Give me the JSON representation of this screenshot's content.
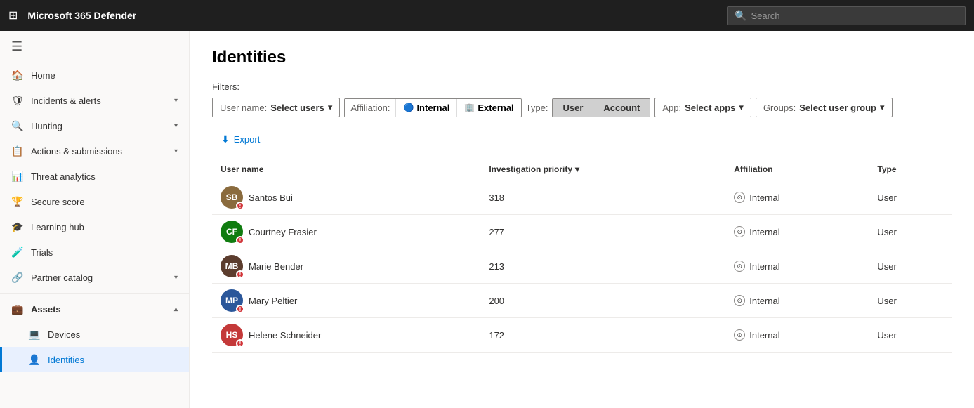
{
  "topbar": {
    "title": "Microsoft 365 Defender",
    "search_placeholder": "Search"
  },
  "sidebar": {
    "toggle_label": "Menu",
    "items": [
      {
        "id": "home",
        "label": "Home",
        "icon": "🏠",
        "expandable": false
      },
      {
        "id": "incidents",
        "label": "Incidents & alerts",
        "icon": "🛡",
        "expandable": true
      },
      {
        "id": "hunting",
        "label": "Hunting",
        "icon": "🔍",
        "expandable": true
      },
      {
        "id": "actions",
        "label": "Actions & submissions",
        "icon": "📋",
        "expandable": true
      },
      {
        "id": "threat",
        "label": "Threat analytics",
        "icon": "📊",
        "expandable": false
      },
      {
        "id": "score",
        "label": "Secure score",
        "icon": "🏆",
        "expandable": false
      },
      {
        "id": "learning",
        "label": "Learning hub",
        "icon": "🎓",
        "expandable": false
      },
      {
        "id": "trials",
        "label": "Trials",
        "icon": "🧪",
        "expandable": false
      },
      {
        "id": "partner",
        "label": "Partner catalog",
        "icon": "🔗",
        "expandable": true
      },
      {
        "id": "assets",
        "label": "Assets",
        "icon": "💼",
        "expandable": true,
        "section": true
      },
      {
        "id": "devices",
        "label": "Devices",
        "icon": "💻",
        "expandable": false,
        "indent": true
      },
      {
        "id": "identities",
        "label": "Identities",
        "icon": "👤",
        "expandable": false,
        "indent": true,
        "active": true
      }
    ]
  },
  "main": {
    "page_title": "Identities",
    "filters_label": "Filters:",
    "filters": {
      "username_label": "User name:",
      "username_value": "Select users",
      "affiliation_label": "Affiliation:",
      "internal_label": "Internal",
      "external_label": "External",
      "type_label": "Type:",
      "type_user": "User",
      "type_account": "Account",
      "app_label": "App:",
      "app_value": "Select apps",
      "groups_label": "Groups:",
      "groups_value": "Select user group"
    },
    "export_label": "Export",
    "table": {
      "columns": [
        "User name",
        "Investigation priority",
        "Affiliation",
        "Type"
      ],
      "rows": [
        {
          "id": 1,
          "name": "Santos Bui",
          "initials": "SB",
          "avatar_color": "#8a6b3e",
          "priority": "318",
          "affiliation": "Internal",
          "type": "User"
        },
        {
          "id": 2,
          "name": "Courtney Frasier",
          "initials": "CF",
          "avatar_color": "#107c10",
          "priority": "277",
          "affiliation": "Internal",
          "type": "User"
        },
        {
          "id": 3,
          "name": "Marie Bender",
          "initials": "MB",
          "avatar_color": "#5c3d2e",
          "priority": "213",
          "affiliation": "Internal",
          "type": "User"
        },
        {
          "id": 4,
          "name": "Mary Peltier",
          "initials": "MP",
          "avatar_color": "#2b579a",
          "priority": "200",
          "affiliation": "Internal",
          "type": "User"
        },
        {
          "id": 5,
          "name": "Helene Schneider",
          "initials": "HS",
          "avatar_color": "#c43939",
          "priority": "172",
          "affiliation": "Internal",
          "type": "User"
        }
      ]
    }
  }
}
